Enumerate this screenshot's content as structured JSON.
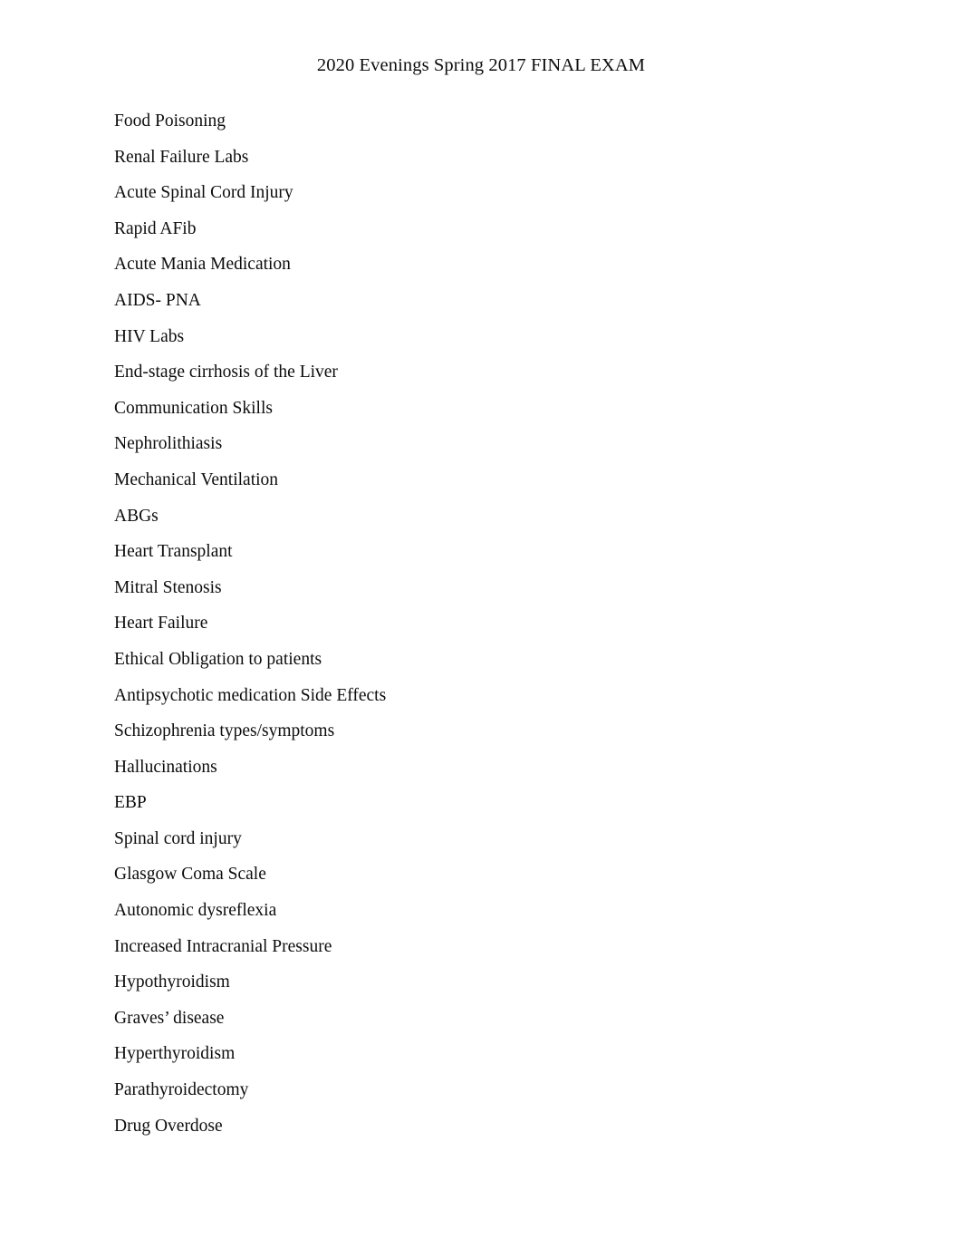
{
  "document": {
    "header": {
      "title": "2020 Evenings Spring 2017 FINAL EXAM"
    },
    "background_color": "#ffffff",
    "text_color": "#0d0d0d",
    "topics": [
      {
        "label": "Food Poisoning"
      },
      {
        "label": "Renal Failure Labs"
      },
      {
        "label": "Acute Spinal Cord Injury"
      },
      {
        "label": "Rapid AFib"
      },
      {
        "label": "Acute Mania Medication"
      },
      {
        "label": "AIDS- PNA"
      },
      {
        "label": "HIV Labs"
      },
      {
        "label": "End-stage cirrhosis of the Liver"
      },
      {
        "label": "Communication Skills"
      },
      {
        "label": "Nephrolithiasis"
      },
      {
        "label": "Mechanical Ventilation"
      },
      {
        "label": "ABGs"
      },
      {
        "label": "Heart Transplant"
      },
      {
        "label": "Mitral Stenosis"
      },
      {
        "label": "Heart Failure"
      },
      {
        "label": "Ethical Obligation to patients"
      },
      {
        "label": "Antipsychotic medication Side Effects"
      },
      {
        "label": "Schizophrenia types/symptoms"
      },
      {
        "label": "Hallucinations"
      },
      {
        "label": "EBP"
      },
      {
        "label": "Spinal cord injury"
      },
      {
        "label": "Glasgow Coma Scale"
      },
      {
        "label": "Autonomic dysreflexia"
      },
      {
        "label": "Increased Intracranial Pressure"
      },
      {
        "label": "Hypothyroidism"
      },
      {
        "label": "Graves’ disease"
      },
      {
        "label": "Hyperthyroidism"
      },
      {
        "label": "Parathyroidectomy"
      },
      {
        "label": "Drug Overdose"
      }
    ]
  }
}
